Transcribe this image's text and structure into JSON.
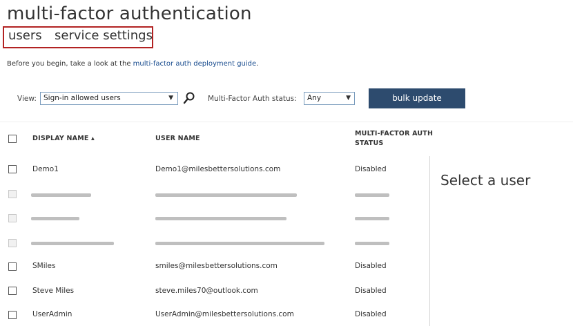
{
  "page": {
    "title": "multi-factor authentication"
  },
  "tabs": [
    {
      "label": "users"
    },
    {
      "label": "service settings"
    }
  ],
  "intro": {
    "prefix": "Before you begin, take a look at the ",
    "link": "multi-factor auth deployment guide",
    "suffix": "."
  },
  "toolbar": {
    "view_label": "View:",
    "view_selected": "Sign-in allowed users",
    "mfa_status_label": "Multi-Factor Auth status:",
    "mfa_status_selected": "Any",
    "bulk_update_label": "bulk update"
  },
  "table": {
    "columns": {
      "display_name": "DISPLAY NAME ▴",
      "user_name": "USER NAME",
      "mfa_status_line1": "MULTI-FACTOR AUTH",
      "mfa_status_line2": "STATUS"
    },
    "rows": [
      {
        "display_name": "Demo1",
        "user_name": "Demo1@milesbettersolutions.com",
        "status": "Disabled",
        "redacted": false
      },
      {
        "display_name": "",
        "user_name": "",
        "status": "",
        "redacted": true
      },
      {
        "display_name": "",
        "user_name": "",
        "status": "",
        "redacted": true
      },
      {
        "display_name": "",
        "user_name": "",
        "status": "",
        "redacted": true
      },
      {
        "display_name": "SMiles",
        "user_name": "smiles@milesbettersolutions.com",
        "status": "Disabled",
        "redacted": false
      },
      {
        "display_name": "Steve Miles",
        "user_name": "steve.miles70@outlook.com",
        "status": "Disabled",
        "redacted": false
      },
      {
        "display_name": "UserAdmin",
        "user_name": "UserAdmin@milesbettersolutions.com",
        "status": "Disabled",
        "redacted": false
      }
    ]
  },
  "details_pane": {
    "placeholder": "Select a user"
  },
  "colors": {
    "accent_button": "#2d4b6e",
    "tab_highlight_border": "#b22222",
    "link": "#1a4d8f"
  }
}
